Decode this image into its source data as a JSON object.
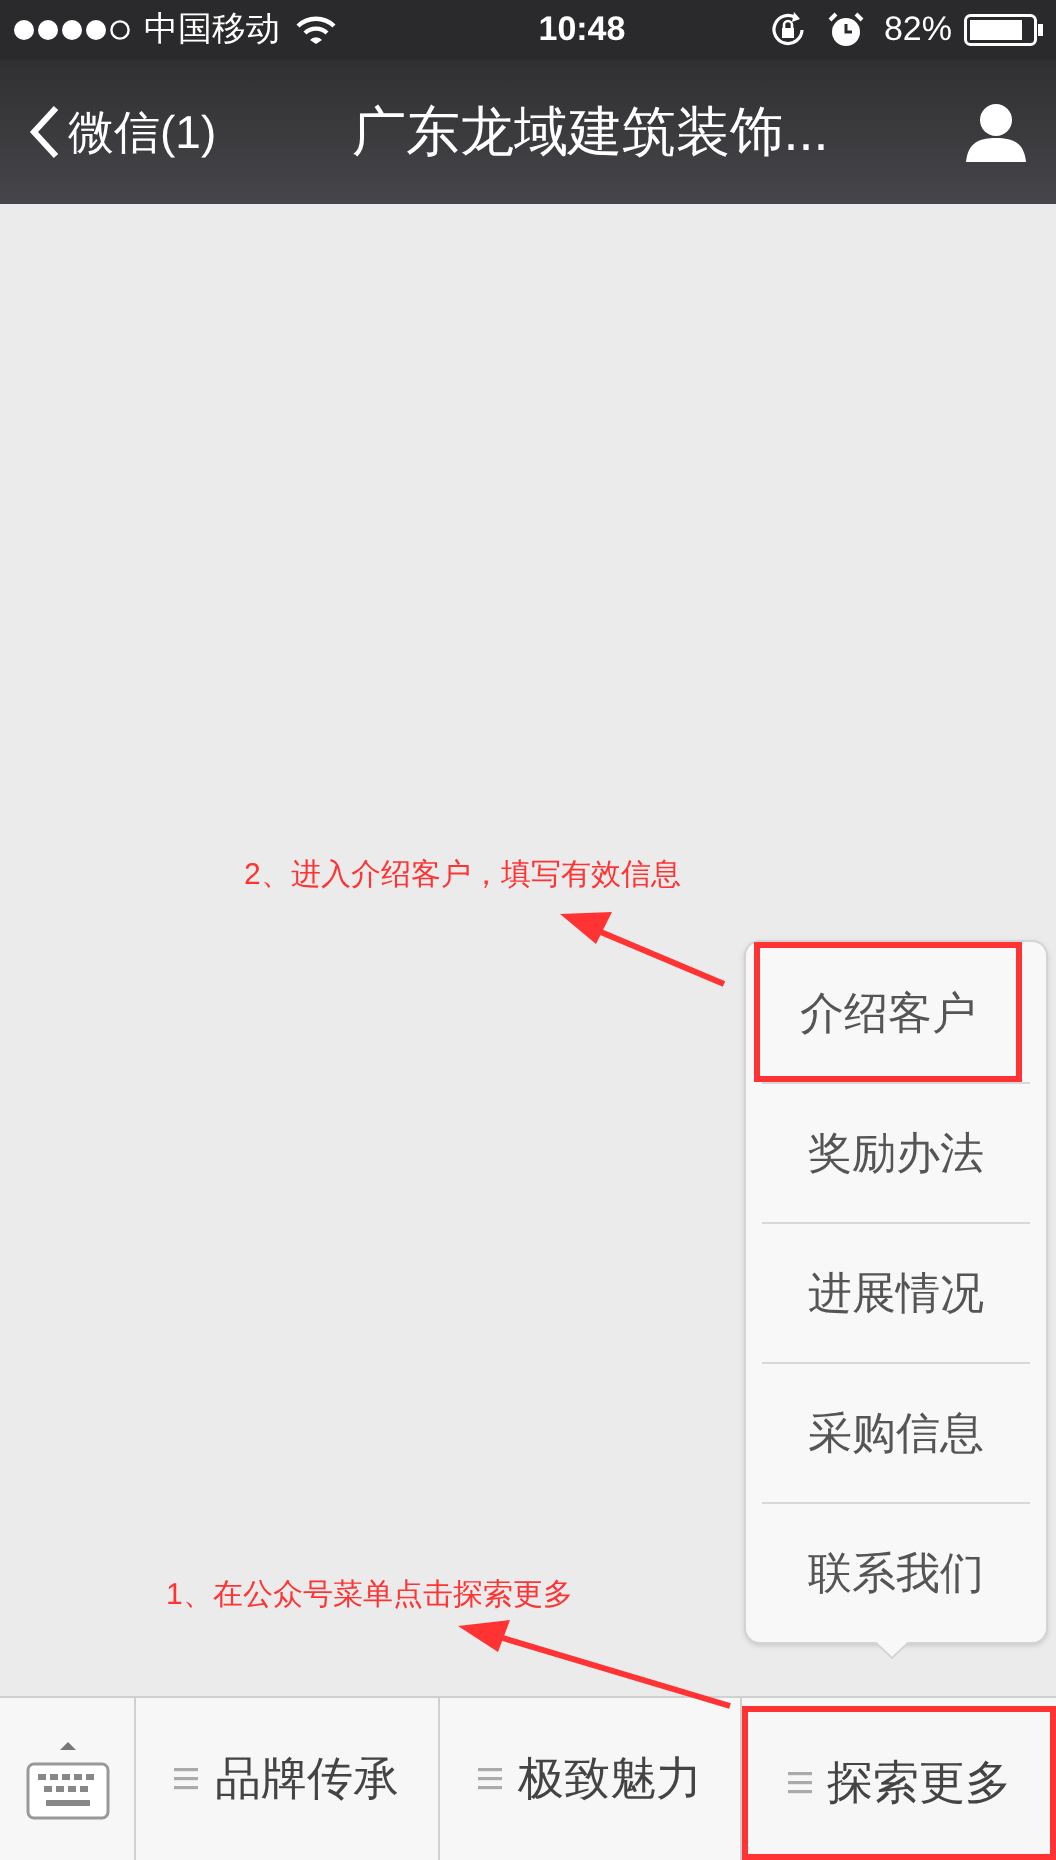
{
  "status_bar": {
    "carrier": "中国移动",
    "time": "10:48",
    "battery": "82%"
  },
  "nav_bar": {
    "back_label": "微信(1)",
    "title": "广东龙域建筑装饰..."
  },
  "popup_menu": {
    "items": [
      {
        "label": "介绍客户",
        "highlighted": true
      },
      {
        "label": "奖励办法",
        "highlighted": false
      },
      {
        "label": "进展情况",
        "highlighted": false
      },
      {
        "label": "采购信息",
        "highlighted": false
      },
      {
        "label": "联系我们",
        "highlighted": false
      }
    ]
  },
  "menu_bar": {
    "items": [
      {
        "label": "品牌传承",
        "highlighted": false
      },
      {
        "label": "极致魅力",
        "highlighted": false
      },
      {
        "label": "探索更多",
        "highlighted": true
      }
    ]
  },
  "annotations": [
    {
      "text": "2、进入介绍客户，填写有效信息"
    },
    {
      "text": "1、在公众号菜单点击探索更多"
    }
  ]
}
